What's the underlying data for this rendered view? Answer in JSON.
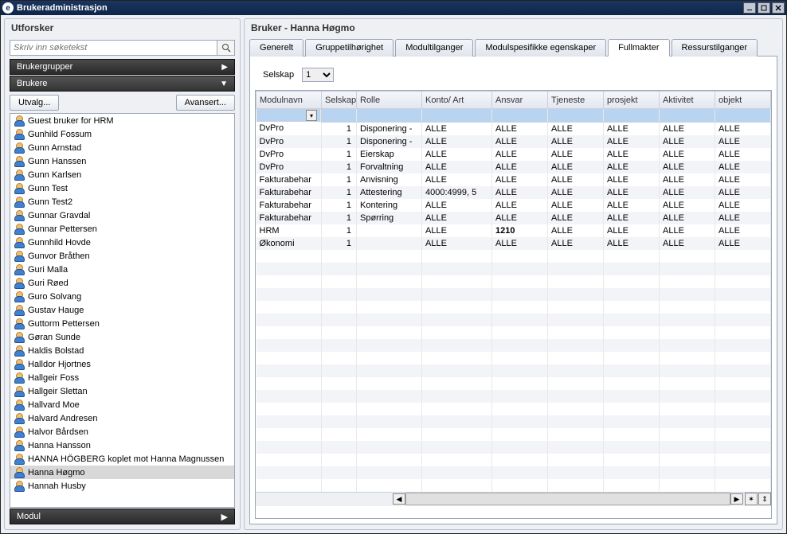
{
  "titlebar": {
    "app_icon_letter": "e",
    "title": "Brukeradministrasjon"
  },
  "explorer": {
    "panel_title": "Utforsker",
    "search_placeholder": "Skriv inn søketekst",
    "nav_groups": "Brukergrupper",
    "nav_users": "Brukere",
    "btn_utvalg": "Utvalg...",
    "btn_avansert": "Avansert...",
    "nav_modul": "Modul",
    "users": [
      "Guest bruker for HRM",
      "Gunhild Fossum",
      "Gunn Arnstad",
      "Gunn Hanssen",
      "Gunn Karlsen",
      "Gunn Test",
      "Gunn Test2",
      "Gunnar Gravdal",
      "Gunnar Pettersen",
      "Gunnhild Hovde",
      "Gunvor Bråthen",
      "Guri Malla",
      "Guri Røed",
      "Guro Solvang",
      "Gustav Hauge",
      "Guttorm Pettersen",
      "Gøran Sunde",
      "Haldis Bolstad",
      "Halldor Hjortnes",
      "Hallgeir Foss",
      "Hallgeir Slettan",
      "Hallvard Moe",
      "Halvard Andresen",
      "Halvor Bårdsen",
      "Hanna Hansson",
      "HANNA HÖGBERG koplet mot Hanna Magnussen",
      "Hanna Høgmo",
      "Hannah Husby"
    ],
    "selected_user_index": 26
  },
  "main": {
    "panel_title": "Bruker - Hanna Høgmo",
    "tabs": {
      "generelt": "Generelt",
      "gruppe": "Gruppetilhørighet",
      "modultilganger": "Modultilganger",
      "modulspes": "Modulspesifikke egenskaper",
      "fullmakter": "Fullmakter",
      "ressurs": "Ressurstilganger"
    },
    "selskap_label": "Selskap",
    "selskap_value": "1",
    "columns": {
      "modulnavn": "Modulnavn",
      "selskap": "Selskap",
      "rolle": "Rolle",
      "konto": "Konto/ Art",
      "ansvar": "Ansvar",
      "tjeneste": "Tjeneste",
      "prosjekt": "prosjekt",
      "aktivitet": "Aktivitet",
      "objekt": "objekt"
    },
    "rows": [
      {
        "modul": "DvPro",
        "selskap": "1",
        "rolle": "Disponering -",
        "konto": "ALLE",
        "ansvar": "ALLE",
        "tjeneste": "ALLE",
        "prosjekt": "ALLE",
        "aktivitet": "ALLE",
        "objekt": "ALLE"
      },
      {
        "modul": "DvPro",
        "selskap": "1",
        "rolle": "Disponering -",
        "konto": "ALLE",
        "ansvar": "ALLE",
        "tjeneste": "ALLE",
        "prosjekt": "ALLE",
        "aktivitet": "ALLE",
        "objekt": "ALLE"
      },
      {
        "modul": "DvPro",
        "selskap": "1",
        "rolle": "Eierskap",
        "konto": "ALLE",
        "ansvar": "ALLE",
        "tjeneste": "ALLE",
        "prosjekt": "ALLE",
        "aktivitet": "ALLE",
        "objekt": "ALLE"
      },
      {
        "modul": "DvPro",
        "selskap": "1",
        "rolle": "Forvaltning",
        "konto": "ALLE",
        "ansvar": "ALLE",
        "tjeneste": "ALLE",
        "prosjekt": "ALLE",
        "aktivitet": "ALLE",
        "objekt": "ALLE"
      },
      {
        "modul": "Fakturabehar",
        "selskap": "1",
        "rolle": "Anvisning",
        "konto": "ALLE",
        "ansvar": "ALLE",
        "tjeneste": "ALLE",
        "prosjekt": "ALLE",
        "aktivitet": "ALLE",
        "objekt": "ALLE"
      },
      {
        "modul": "Fakturabehar",
        "selskap": "1",
        "rolle": "Attestering",
        "konto": "4000:4999, 5",
        "ansvar": "ALLE",
        "tjeneste": "ALLE",
        "prosjekt": "ALLE",
        "aktivitet": "ALLE",
        "objekt": "ALLE"
      },
      {
        "modul": "Fakturabehar",
        "selskap": "1",
        "rolle": "Kontering",
        "konto": "ALLE",
        "ansvar": "ALLE",
        "tjeneste": "ALLE",
        "prosjekt": "ALLE",
        "aktivitet": "ALLE",
        "objekt": "ALLE"
      },
      {
        "modul": "Fakturabehar",
        "selskap": "1",
        "rolle": "Spørring",
        "konto": "ALLE",
        "ansvar": "ALLE",
        "tjeneste": "ALLE",
        "prosjekt": "ALLE",
        "aktivitet": "ALLE",
        "objekt": "ALLE"
      },
      {
        "modul": "HRM",
        "selskap": "1",
        "rolle": "",
        "konto": "ALLE",
        "ansvar": "1210",
        "ansvar_bold": true,
        "tjeneste": "ALLE",
        "prosjekt": "ALLE",
        "aktivitet": "ALLE",
        "objekt": "ALLE"
      },
      {
        "modul": "Økonomi",
        "selskap": "1",
        "rolle": "",
        "konto": "ALLE",
        "ansvar": "ALLE",
        "tjeneste": "ALLE",
        "prosjekt": "ALLE",
        "aktivitet": "ALLE",
        "objekt": "ALLE"
      }
    ]
  }
}
